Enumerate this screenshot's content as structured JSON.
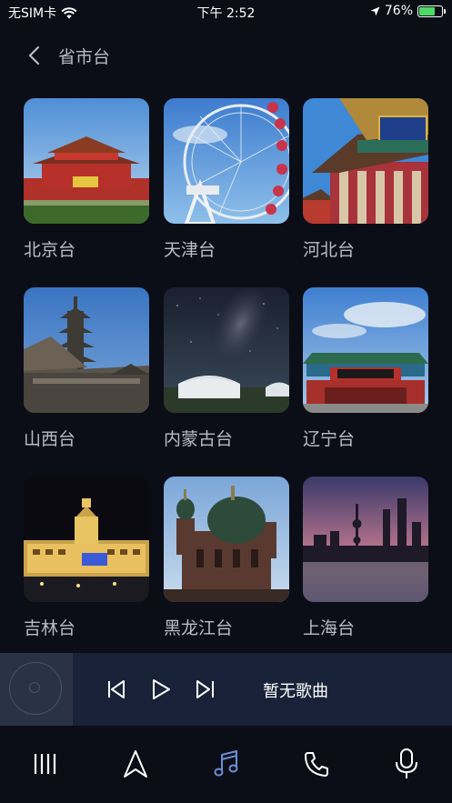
{
  "status_bar": {
    "carrier": "无SIM卡",
    "time": "下午 2:52",
    "battery": "76%",
    "battery_level": 0.76
  },
  "header": {
    "title": "省市台"
  },
  "stations": [
    {
      "name": "北京台"
    },
    {
      "name": "天津台"
    },
    {
      "name": "河北台"
    },
    {
      "name": "山西台"
    },
    {
      "name": "内蒙古台"
    },
    {
      "name": "辽宁台"
    },
    {
      "name": "吉林台"
    },
    {
      "name": "黑龙江台"
    },
    {
      "name": "上海台"
    }
  ],
  "player": {
    "song_title": "暂无歌曲"
  },
  "nav": {
    "items": [
      "menu-icon",
      "navigation-icon",
      "music-icon",
      "phone-icon",
      "microphone-icon"
    ],
    "active": "music-icon",
    "active_color": "#6a8fd8"
  }
}
